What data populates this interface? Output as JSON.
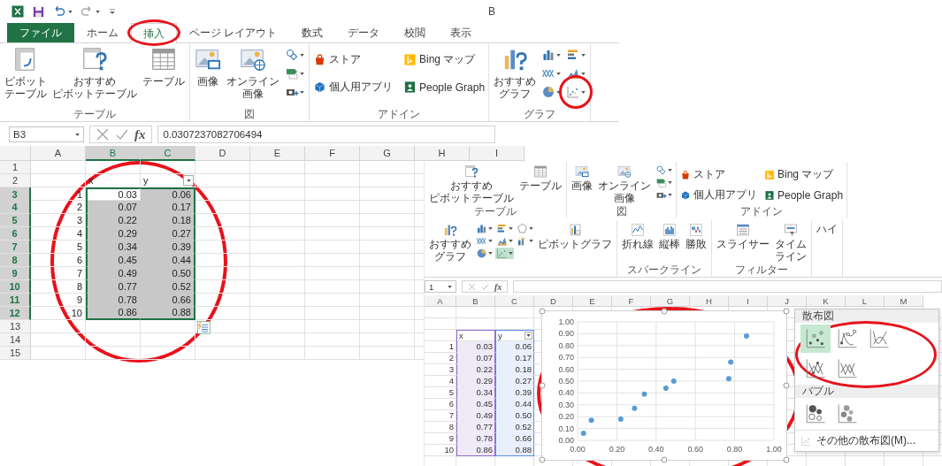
{
  "left_window": {
    "title": "B",
    "tabs": [
      {
        "label": "ファイル",
        "kind": "file",
        "selected": false
      },
      {
        "label": "ホーム",
        "kind": "tab",
        "selected": false
      },
      {
        "label": "挿入",
        "kind": "tab",
        "selected": true
      },
      {
        "label": "ページ レイアウト",
        "kind": "tab",
        "selected": false
      },
      {
        "label": "数式",
        "kind": "tab",
        "selected": false
      },
      {
        "label": "データ",
        "kind": "tab",
        "selected": false
      },
      {
        "label": "校閲",
        "kind": "tab",
        "selected": false
      },
      {
        "label": "表示",
        "kind": "tab",
        "selected": false
      }
    ],
    "ribbon_groups": [
      {
        "label": "テーブル",
        "buttons": [
          {
            "kind": "pivot",
            "label_lines": [
              "ピボット",
              "テーブル"
            ]
          },
          {
            "kind": "recommend",
            "label_lines": [
              "おすすめ",
              "ピボットテーブル"
            ]
          },
          {
            "kind": "table",
            "label_lines": [
              "テーブル"
            ]
          }
        ]
      },
      {
        "label": "図",
        "buttons": [
          {
            "kind": "picture",
            "label_lines": [
              "画像"
            ]
          },
          {
            "kind": "online",
            "label_lines": [
              "オンライン",
              "画像"
            ]
          },
          {
            "kind": "stack",
            "items": [
              {
                "kind": "shapes"
              },
              {
                "kind": "smartart"
              },
              {
                "kind": "screenshot"
              }
            ]
          }
        ]
      },
      {
        "label": "アドイン",
        "buttons": [
          {
            "kind": "grid",
            "items": [
              {
                "kind": "store",
                "label": "ストア"
              },
              {
                "kind": "apps",
                "label": "個人用アプリ"
              },
              {
                "kind": "bing",
                "label": "Bing マップ"
              },
              {
                "kind": "people",
                "label": "People Graph"
              }
            ]
          }
        ]
      },
      {
        "label": "グラフ",
        "buttons": [
          {
            "kind": "recochart",
            "label_lines": [
              "おすすめ",
              "グラフ"
            ]
          },
          {
            "kind": "stack",
            "items": [
              {
                "kind": "bar",
                "selected": false
              },
              {
                "kind": "line",
                "selected": false
              },
              {
                "kind": "pie",
                "selected": false
              },
              {
                "kind": "hbar",
                "selected": false
              },
              {
                "kind": "area",
                "selected": false
              },
              {
                "kind": "scatter",
                "selected": false
              }
            ]
          }
        ]
      }
    ],
    "name_box": "B3",
    "function_button": "fx",
    "formula": "0.0307237082706494",
    "columns": [
      {
        "label": "A",
        "selected": false
      },
      {
        "label": "B",
        "selected": true
      },
      {
        "label": "C",
        "selected": true
      },
      {
        "label": "D",
        "selected": false
      },
      {
        "label": "E",
        "selected": false
      },
      {
        "label": "F",
        "selected": false
      },
      {
        "label": "G",
        "selected": false
      },
      {
        "label": "H",
        "selected": false
      },
      {
        "label": "I",
        "selected": false
      }
    ],
    "rows": [
      {
        "label": "1",
        "selected": false
      },
      {
        "label": "2",
        "selected": false,
        "column_b": {
          "text": "x"
        },
        "column_c": {
          "text": "y",
          "filter": true
        }
      },
      {
        "label": "3",
        "selected": true,
        "column_a": {
          "text": "1"
        },
        "column_b": {
          "text": "0.03",
          "shaded": false
        },
        "column_c": {
          "text": "0.06",
          "shaded": true
        }
      },
      {
        "label": "4",
        "selected": true,
        "column_a": {
          "text": "2"
        },
        "column_b": {
          "text": "0.07",
          "shaded": true
        },
        "column_c": {
          "text": "0.17",
          "shaded": true
        }
      },
      {
        "label": "5",
        "selected": true,
        "column_a": {
          "text": "3"
        },
        "column_b": {
          "text": "0.22",
          "shaded": true
        },
        "column_c": {
          "text": "0.18",
          "shaded": true
        }
      },
      {
        "label": "6",
        "selected": true,
        "column_a": {
          "text": "4"
        },
        "column_b": {
          "text": "0.29",
          "shaded": true
        },
        "column_c": {
          "text": "0.27",
          "shaded": true
        }
      },
      {
        "label": "7",
        "selected": true,
        "column_a": {
          "text": "5"
        },
        "column_b": {
          "text": "0.34",
          "shaded": true
        },
        "column_c": {
          "text": "0.39",
          "shaded": true
        }
      },
      {
        "label": "8",
        "selected": true,
        "column_a": {
          "text": "6"
        },
        "column_b": {
          "text": "0.45",
          "shaded": true
        },
        "column_c": {
          "text": "0.44",
          "shaded": true
        }
      },
      {
        "label": "9",
        "selected": true,
        "column_a": {
          "text": "7"
        },
        "column_b": {
          "text": "0.49",
          "shaded": true
        },
        "column_c": {
          "text": "0.50",
          "shaded": true
        }
      },
      {
        "label": "10",
        "selected": true,
        "column_a": {
          "text": "8"
        },
        "column_b": {
          "text": "0.77",
          "shaded": true
        },
        "column_c": {
          "text": "0.52",
          "shaded": true
        }
      },
      {
        "label": "11",
        "selected": true,
        "column_a": {
          "text": "9"
        },
        "column_b": {
          "text": "0.78",
          "shaded": true
        },
        "column_c": {
          "text": "0.66",
          "shaded": true
        }
      },
      {
        "label": "12",
        "selected": true,
        "column_a": {
          "text": "10"
        },
        "column_b": {
          "text": "0.86",
          "shaded": true
        },
        "column_c": {
          "text": "0.88",
          "shaded": true
        }
      },
      {
        "label": "13",
        "selected": false
      },
      {
        "label": "14",
        "selected": false
      },
      {
        "label": "15",
        "selected": false
      }
    ]
  },
  "right_window": {
    "ribbon_groups": [
      {
        "label": "テーブル",
        "buttons": [
          {
            "kind": "recommend",
            "label_lines": [
              "おすすめ",
              "ピボットテーブル"
            ]
          },
          {
            "kind": "table",
            "label_lines": [
              "テーブル"
            ]
          }
        ]
      },
      {
        "label": "図",
        "buttons": [
          {
            "kind": "picture",
            "label_lines": [
              "画像"
            ]
          },
          {
            "kind": "online",
            "label_lines": [
              "オンライン",
              "画像"
            ]
          },
          {
            "kind": "stack",
            "items": [
              {
                "kind": "shapes"
              },
              {
                "kind": "smartart"
              },
              {
                "kind": "screenshot"
              }
            ]
          }
        ]
      },
      {
        "label": "アドイン",
        "buttons": [
          {
            "kind": "grid",
            "items": [
              {
                "kind": "store",
                "label": "ストア"
              },
              {
                "kind": "apps",
                "label": "個人用アプリ"
              },
              {
                "kind": "bing",
                "label": "Bing マップ"
              },
              {
                "kind": "people",
                "label": "People Graph"
              }
            ]
          }
        ]
      },
      {
        "buttons": [
          {
            "kind": "recochart",
            "label_lines": [
              "おすすめ",
              "グラフ"
            ]
          },
          {
            "kind": "stack",
            "items": [
              {
                "kind": "bar",
                "selected": false
              },
              {
                "kind": "line",
                "selected": false
              },
              {
                "kind": "pie",
                "selected": false
              },
              {
                "kind": "hbar",
                "selected": false
              },
              {
                "kind": "area",
                "selected": false
              },
              {
                "kind": "scatter",
                "selected": true
              },
              {
                "kind": "radar",
                "selected": false
              },
              {
                "kind": "combo",
                "selected": false
              }
            ]
          },
          {
            "kind": "pivotchart",
            "label_lines": [
              "ピボットグラフ"
            ]
          }
        ]
      },
      {
        "label": "スパークライン",
        "buttons": [
          {
            "kind": "sparkline",
            "label_lines": [
              "折れ線"
            ]
          },
          {
            "kind": "sparkcol",
            "label_lines": [
              "縦棒"
            ]
          },
          {
            "kind": "winloss",
            "label_lines": [
              "勝敗"
            ]
          }
        ]
      },
      {
        "label": "フィルター",
        "buttons": [
          {
            "kind": "slicer",
            "label_lines": [
              "スライサー"
            ]
          },
          {
            "kind": "timeline",
            "label_lines": [
              "タイム",
              "ライン"
            ]
          }
        ]
      },
      {
        "buttons": [
          {
            "kind": "text",
            "label_lines": [
              "ハイ"
            ]
          }
        ]
      }
    ],
    "name_box": "1",
    "function_button": "fx",
    "columns": [
      "A",
      "B",
      "C",
      "D",
      "E",
      "F",
      "G",
      "H",
      "I",
      "J",
      "K",
      "L",
      "M"
    ],
    "rows": [
      {
        "kind": "header",
        "column_b": "x",
        "column_c": "y",
        "filter": true
      },
      {
        "kind": "data",
        "column_a": "1",
        "column_b": "0.03",
        "column_c": "0.06"
      },
      {
        "kind": "data",
        "column_a": "2",
        "column_b": "0.07",
        "column_c": "0.17"
      },
      {
        "kind": "data",
        "column_a": "3",
        "column_b": "0.22",
        "column_c": "0.18"
      },
      {
        "kind": "data",
        "column_a": "4",
        "column_b": "0.29",
        "column_c": "0.27"
      },
      {
        "kind": "data",
        "column_a": "5",
        "column_b": "0.34",
        "column_c": "0.39"
      },
      {
        "kind": "data",
        "column_a": "6",
        "column_b": "0.45",
        "column_c": "0.44"
      },
      {
        "kind": "data",
        "column_a": "7",
        "column_b": "0.49",
        "column_c": "0.50"
      },
      {
        "kind": "data",
        "column_a": "8",
        "column_b": "0.77",
        "column_c": "0.52"
      },
      {
        "kind": "data",
        "column_a": "9",
        "column_b": "0.78",
        "column_c": "0.66"
      },
      {
        "kind": "data",
        "column_a": "10",
        "column_b": "0.86",
        "column_c": "0.88"
      }
    ],
    "chart_menu": {
      "sections": [
        {
          "label": "散布図",
          "items": [
            {
              "kind": "mk",
              "selected": true
            },
            {
              "kind": "smk",
              "selected": false
            },
            {
              "kind": "sm",
              "selected": false
            },
            {
              "kind": "stmk",
              "selected": false
            },
            {
              "kind": "st",
              "selected": false
            }
          ]
        },
        {
          "label": "バブル",
          "items": [
            {
              "kind": "bubble",
              "selected": false
            },
            {
              "kind": "bubble3d",
              "selected": false
            }
          ]
        }
      ],
      "more_label": "その他の散布図(M)..."
    },
    "chart": {
      "chart_data": {
        "type": "scatter",
        "grid": true,
        "x": [
          0.03,
          0.07,
          0.22,
          0.29,
          0.34,
          0.45,
          0.49,
          0.77,
          0.78,
          0.86
        ],
        "series": [
          {
            "color": "#5b9bd5",
            "values": [
              0.06,
              0.17,
              0.18,
              0.27,
              0.39,
              0.44,
              0.5,
              0.52,
              0.66,
              0.88
            ]
          }
        ],
        "xlim": [
          0,
          1
        ],
        "ylim": [
          0,
          1
        ],
        "xticks": [
          {
            "value": 0,
            "label": "0.00"
          },
          {
            "value": 0.2,
            "label": "0.20"
          },
          {
            "value": 0.4,
            "label": "0.40"
          },
          {
            "value": 0.6,
            "label": "0.60"
          },
          {
            "value": 0.8,
            "label": "0.80"
          },
          {
            "value": 1,
            "label": "1.00"
          }
        ],
        "yticks": [
          {
            "value": 0,
            "label": "0.00"
          },
          {
            "value": 0.1,
            "label": "0.10"
          },
          {
            "value": 0.2,
            "label": "0.20"
          },
          {
            "value": 0.3,
            "label": "0.30"
          },
          {
            "value": 0.4,
            "label": "0.40"
          },
          {
            "value": 0.5,
            "label": "0.50"
          },
          {
            "value": 0.6,
            "label": "0.60"
          },
          {
            "value": 0.7,
            "label": "0.70"
          },
          {
            "value": 0.8,
            "label": "0.80"
          },
          {
            "value": 0.9,
            "label": "0.90"
          },
          {
            "value": 1,
            "label": "1.00"
          }
        ]
      }
    }
  }
}
